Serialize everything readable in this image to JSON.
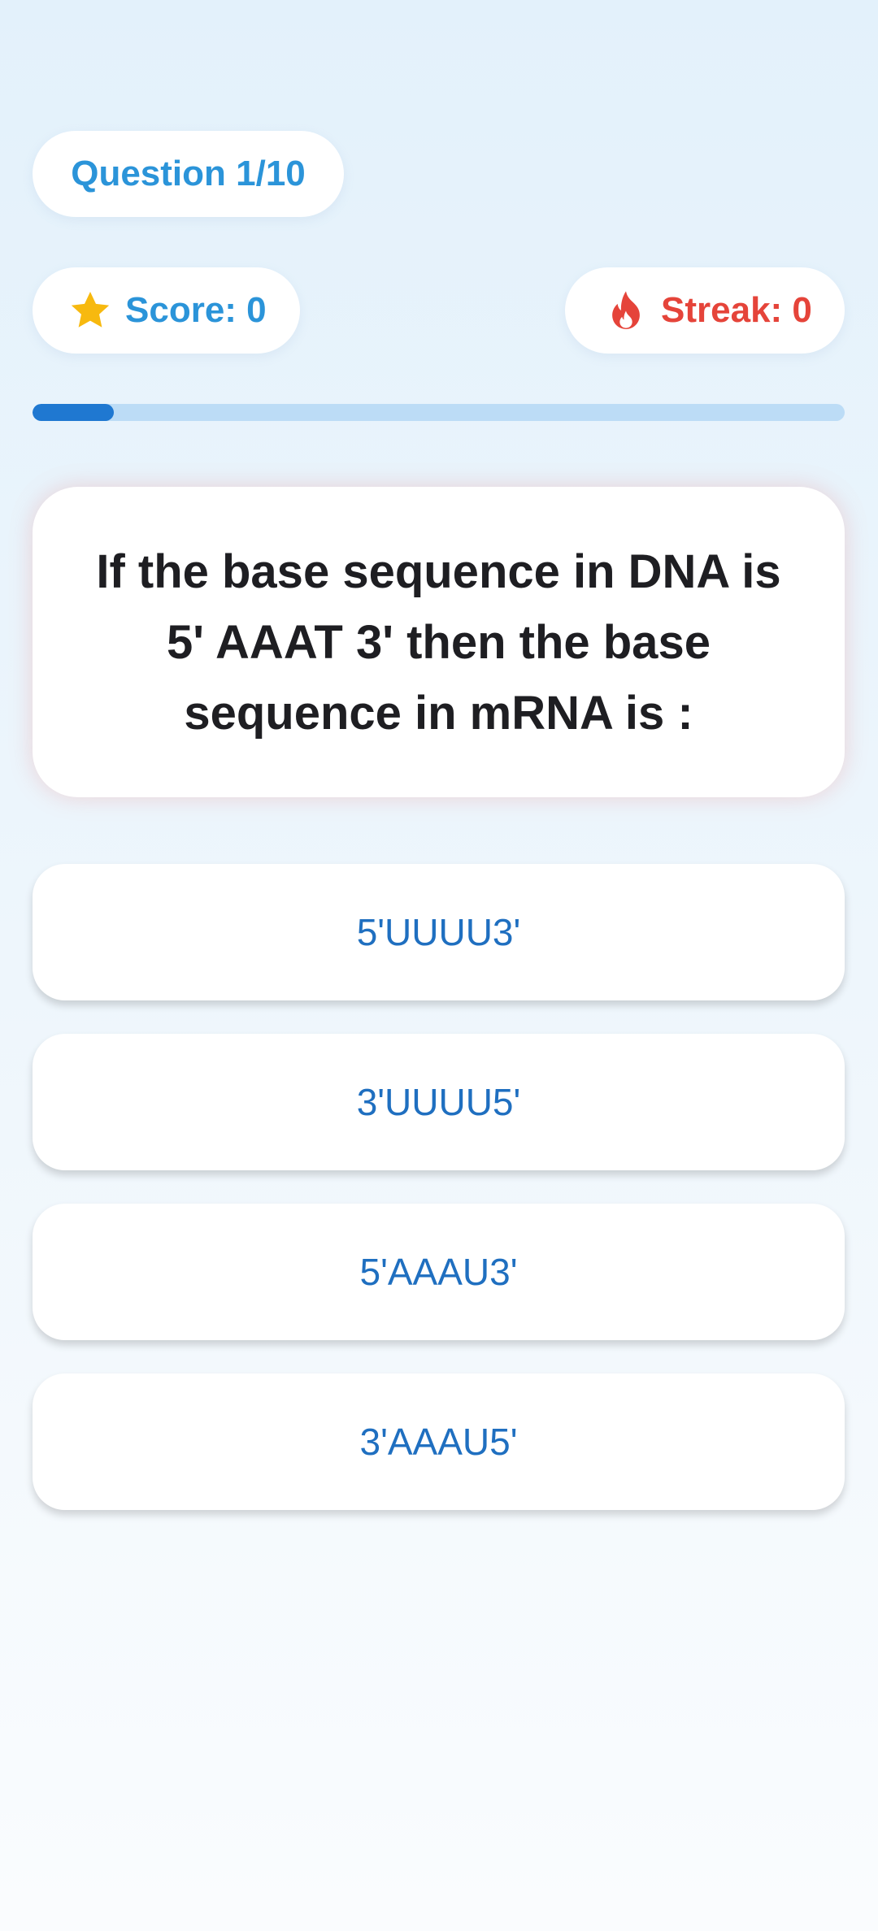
{
  "header": {
    "question_counter": "Question 1/10",
    "score_label": "Score: 0",
    "streak_label": "Streak: 0"
  },
  "progress": {
    "value_fraction": 0.1
  },
  "question": {
    "text": "If the base sequence in DNA is 5' AAAT 3' then the base sequence in mRNA is :"
  },
  "options": [
    {
      "label": "5'UUUU3'"
    },
    {
      "label": "3'UUUU5'"
    },
    {
      "label": "5'AAAU3'"
    },
    {
      "label": "3'AAAU5'"
    }
  ],
  "icons": {
    "score": "star-icon",
    "streak": "flame-icon"
  },
  "colors": {
    "accent_blue": "#2b94d9",
    "streak_red": "#e5443a",
    "progress_fill": "#1f78d1",
    "progress_track": "#bcdcf6",
    "star_gold": "#f7b90f",
    "option_text": "#1f6fc0"
  }
}
